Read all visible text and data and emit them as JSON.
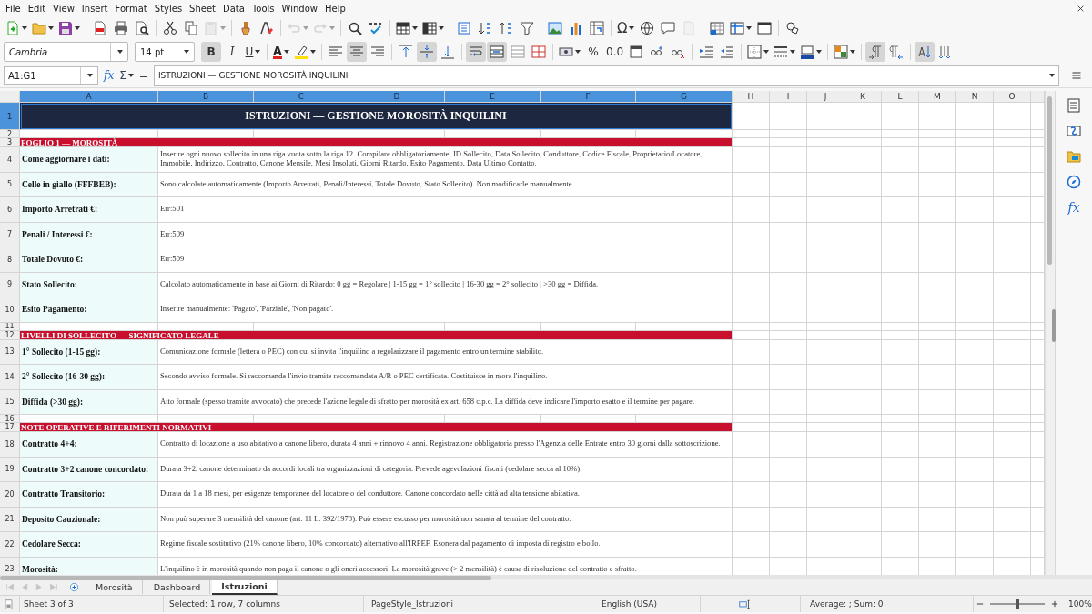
{
  "menu": [
    "File",
    "Edit",
    "View",
    "Insert",
    "Format",
    "Styles",
    "Sheet",
    "Data",
    "Tools",
    "Window",
    "Help"
  ],
  "standard_bar": [
    {
      "kind": "new",
      "dropdown": true,
      "disabled": false
    },
    {
      "kind": "open",
      "dropdown": true,
      "disabled": false
    },
    {
      "kind": "save",
      "dropdown": true,
      "disabled": false
    },
    {
      "kind": "separator"
    },
    {
      "kind": "pdf",
      "disabled": false
    },
    {
      "kind": "print",
      "disabled": false
    },
    {
      "kind": "preview",
      "disabled": false
    },
    {
      "kind": "separator"
    },
    {
      "kind": "cut",
      "disabled": false
    },
    {
      "kind": "copy",
      "disabled": false
    },
    {
      "kind": "paste",
      "dropdown": true,
      "disabled": true
    },
    {
      "kind": "separator"
    },
    {
      "kind": "clone",
      "disabled": false
    },
    {
      "kind": "clear",
      "disabled": false
    },
    {
      "kind": "separator"
    },
    {
      "kind": "undo",
      "dropdown": true,
      "disabled": true
    },
    {
      "kind": "redo",
      "dropdown": true,
      "disabled": true
    },
    {
      "kind": "separator"
    },
    {
      "kind": "find",
      "disabled": false
    },
    {
      "kind": "spell",
      "disabled": false
    },
    {
      "kind": "separator"
    },
    {
      "kind": "row",
      "dropdown": true,
      "disabled": false
    },
    {
      "kind": "column",
      "dropdown": true,
      "disabled": false
    },
    {
      "kind": "separator"
    },
    {
      "kind": "sort",
      "disabled": false
    },
    {
      "kind": "sortasc",
      "disabled": false
    },
    {
      "kind": "sortdesc",
      "disabled": false
    },
    {
      "kind": "filter",
      "disabled": false
    },
    {
      "kind": "separator"
    },
    {
      "kind": "image",
      "disabled": false
    },
    {
      "kind": "chart",
      "disabled": false
    },
    {
      "kind": "pivot",
      "disabled": false
    },
    {
      "kind": "separator"
    },
    {
      "kind": "special",
      "label": "Ω",
      "dropdown": true,
      "disabled": false
    },
    {
      "kind": "link",
      "disabled": false
    },
    {
      "kind": "comment",
      "disabled": false
    },
    {
      "kind": "headerfooter",
      "disabled": true
    },
    {
      "kind": "separator"
    },
    {
      "kind": "printarea",
      "disabled": false
    },
    {
      "kind": "freeze",
      "dropdown": true,
      "disabled": false
    },
    {
      "kind": "split",
      "disabled": false
    },
    {
      "kind": "separator"
    },
    {
      "kind": "draw",
      "disabled": false
    }
  ],
  "font_name": "Cambria",
  "font_size": "14 pt",
  "format_bar": [
    {
      "kind": "bold",
      "label": "B",
      "on": true
    },
    {
      "kind": "italic",
      "label": "I",
      "on": false
    },
    {
      "kind": "underline",
      "label": "U",
      "dropdown": true,
      "on": false
    },
    {
      "kind": "separator"
    },
    {
      "kind": "fontcolor",
      "label": "A",
      "dropdown": true,
      "on": false
    },
    {
      "kind": "highlight",
      "dropdown": true,
      "on": false
    },
    {
      "kind": "separator"
    },
    {
      "kind": "alignleft",
      "on": false
    },
    {
      "kind": "aligncenter",
      "on": true
    },
    {
      "kind": "alignright",
      "on": false
    },
    {
      "kind": "separator"
    },
    {
      "kind": "aligntop",
      "on": false
    },
    {
      "kind": "alignmiddle",
      "on": true
    },
    {
      "kind": "alignbottom",
      "on": false
    },
    {
      "kind": "separator"
    },
    {
      "kind": "wrap",
      "on": true
    },
    {
      "kind": "mergecenter",
      "on": true
    },
    {
      "kind": "merge",
      "on": false
    },
    {
      "kind": "unmerge",
      "on": false
    },
    {
      "kind": "separator"
    },
    {
      "kind": "currency",
      "dropdown": true,
      "on": false
    },
    {
      "kind": "percent",
      "label": "%",
      "on": false
    },
    {
      "kind": "number",
      "label": "0.0",
      "on": false
    },
    {
      "kind": "date",
      "on": false
    },
    {
      "kind": "adddecimal",
      "on": false
    },
    {
      "kind": "deldecimal",
      "on": false
    },
    {
      "kind": "separator"
    },
    {
      "kind": "indent",
      "on": false
    },
    {
      "kind": "outdent",
      "on": false
    },
    {
      "kind": "separator"
    },
    {
      "kind": "borders",
      "dropdown": true,
      "on": false
    },
    {
      "kind": "borderstyle",
      "dropdown": true,
      "on": false
    },
    {
      "kind": "bordercolor",
      "dropdown": true,
      "on": false
    },
    {
      "kind": "separator"
    },
    {
      "kind": "conditional",
      "dropdown": true,
      "on": false
    },
    {
      "kind": "separator"
    },
    {
      "kind": "ltr",
      "on": true
    },
    {
      "kind": "rtl",
      "on": false
    },
    {
      "kind": "separator"
    },
    {
      "kind": "orientation",
      "on": true
    },
    {
      "kind": "stacked",
      "on": false
    }
  ],
  "formula_bar": {
    "cell_ref": "A1:G1",
    "function_wizard": "fx",
    "sum": "Σ",
    "equals": "=",
    "content": "ISTRUZIONI — GESTIONE MOROSITÀ INQUILINI"
  },
  "sidebar": [
    {
      "kind": "properties"
    },
    {
      "kind": "styles"
    },
    {
      "kind": "gallery"
    },
    {
      "kind": "navigator"
    },
    {
      "kind": "functions",
      "label": "fx"
    }
  ],
  "columns": [
    {
      "label": "A",
      "selected": true
    },
    {
      "label": "B",
      "selected": true
    },
    {
      "label": "C",
      "selected": true
    },
    {
      "label": "D",
      "selected": true
    },
    {
      "label": "E",
      "selected": true
    },
    {
      "label": "F",
      "selected": true
    },
    {
      "label": "G",
      "selected": true
    },
    {
      "label": "H",
      "selected": false
    },
    {
      "label": "I",
      "selected": false
    },
    {
      "label": "J",
      "selected": false
    },
    {
      "label": "K",
      "selected": false
    },
    {
      "label": "L",
      "selected": false
    },
    {
      "label": "M",
      "selected": false
    },
    {
      "label": "N",
      "selected": false
    },
    {
      "label": "O",
      "selected": false
    }
  ],
  "rows": [
    {
      "number": "1",
      "selected": true,
      "kind": "title",
      "text": "ISTRUZIONI — GESTIONE MOROSITÀ INQUILINI"
    },
    {
      "number": "2",
      "selected": false,
      "kind": "blank"
    },
    {
      "number": "3",
      "selected": false,
      "kind": "section",
      "text": "FOGLIO 1 — MOROSITÀ"
    },
    {
      "number": "4",
      "selected": false,
      "kind": "entry",
      "label": "Come aggiornare i dati:",
      "text": "Inserire ogni nuovo sollecito in una riga vuota sotto la riga 12. Compilare obbligatoriamente: ID Sollecito, Data Sollecito, Conduttore, Codice Fiscale, Proprietario/Locatore, Immobile, Indirizzo, Contratto, Canone Mensile, Mesi Insoluti, Giorni Ritardo, Esito Pagamento, Data Ultimo Contatto."
    },
    {
      "number": "5",
      "selected": false,
      "kind": "entry",
      "label": "Celle in giallo (FFFBEB):",
      "text": "Sono calcolate automaticamente (Importo Arretrati, Penali/Interessi, Totale Dovuto, Stato Sollecito). Non modificarle manualmente."
    },
    {
      "number": "6",
      "selected": false,
      "kind": "entry",
      "label": "Importo Arretrati €:",
      "text": "Err:501"
    },
    {
      "number": "7",
      "selected": false,
      "kind": "entry",
      "label": "Penali / Interessi €:",
      "text": "Err:509"
    },
    {
      "number": "8",
      "selected": false,
      "kind": "entry",
      "label": "Totale Dovuto €:",
      "text": "Err:509"
    },
    {
      "number": "9",
      "selected": false,
      "kind": "entry",
      "label": "Stato Sollecito:",
      "text": "Calcolato automaticamente in base ai Giorni di Ritardo: 0 gg = Regolare | 1-15 gg = 1° sollecito | 16-30 gg = 2° sollecito | >30 gg = Diffida."
    },
    {
      "number": "10",
      "selected": false,
      "kind": "entry",
      "label": "Esito Pagamento:",
      "text": "Inserire manualmente: 'Pagato', 'Parziale', 'Non pagato'."
    },
    {
      "number": "11",
      "selected": false,
      "kind": "blank"
    },
    {
      "number": "12",
      "selected": false,
      "kind": "section",
      "text": "LIVELLI DI SOLLECITO — SIGNIFICATO LEGALE"
    },
    {
      "number": "13",
      "selected": false,
      "kind": "entry",
      "label": "1° Sollecito (1-15 gg):",
      "text": "Comunicazione formale (lettera o PEC) con cui si invita l'inquilino a regolarizzare il pagamento entro un termine stabilito."
    },
    {
      "number": "14",
      "selected": false,
      "kind": "entry",
      "label": "2° Sollecito (16-30 gg):",
      "text": "Secondo avviso formale. Si raccomanda l'invio tramite raccomandata A/R o PEC certificata. Costituisce in mora l'inquilino."
    },
    {
      "number": "15",
      "selected": false,
      "kind": "entry",
      "label": "Diffida (>30 gg):",
      "text": "Atto formale (spesso tramite avvocato) che precede l'azione legale di sfratto per morosità ex art. 658 c.p.c. La diffida deve indicare l'importo esatto e il termine per pagare."
    },
    {
      "number": "16",
      "selected": false,
      "kind": "blank"
    },
    {
      "number": "17",
      "selected": false,
      "kind": "section",
      "text": "NOTE OPERATIVE E RIFERIMENTI NORMATIVI"
    },
    {
      "number": "18",
      "selected": false,
      "kind": "entry",
      "label": "Contratto 4+4:",
      "text": "Contratto di locazione a uso abitativo a canone libero, durata 4 anni + rinnovo 4 anni. Registrazione obbligatoria presso l'Agenzia delle Entrate entro 30 giorni dalla sottoscrizione."
    },
    {
      "number": "19",
      "selected": false,
      "kind": "entry",
      "label": "Contratto 3+2 canone concordato:",
      "text": "Durata 3+2, canone determinato da accordi locali tra organizzazioni di categoria. Prevede agevolazioni fiscali (cedolare secca al 10%)."
    },
    {
      "number": "20",
      "selected": false,
      "kind": "entry",
      "label": "Contratto Transitorio:",
      "text": "Durata da 1 a 18 mesi, per esigenze temporanee del locatore o del conduttore. Canone concordato nelle città ad alta tensione abitativa."
    },
    {
      "number": "21",
      "selected": false,
      "kind": "entry",
      "label": "Deposito Cauzionale:",
      "text": "Non può superare 3 mensilità del canone (art. 11 L. 392/1978). Può essere escusso per morosità non sanata al termine del contratto."
    },
    {
      "number": "22",
      "selected": false,
      "kind": "entry",
      "label": "Cedolare Secca:",
      "text": "Regime fiscale sostitutivo (21% canone libero, 10% concordato) alternativo all'IRPEF. Esonera dal pagamento di imposta di registro e bollo."
    },
    {
      "number": "23",
      "selected": false,
      "kind": "entry",
      "label": "Morosità:",
      "text": "L'inquilino è in morosità quando non paga il canone o gli oneri accessori. La morosità grave (> 2 mensilità) è causa di risoluzione del contratto e sfratto."
    }
  ],
  "tabs": [
    {
      "label": "Morosità",
      "selected": false
    },
    {
      "label": "Dashboard",
      "selected": false
    },
    {
      "label": "Istruzioni",
      "selected": true
    }
  ],
  "status_bar": {
    "sheet": "Sheet 3 of 3",
    "selection": "Selected: 1 row, 7 columns",
    "page_style": "PageStyle_Istruzioni",
    "language": "English (USA)",
    "sum": "Average: ; Sum: 0",
    "zoom": "100%",
    "zoom_slider": {
      "level": 0.5
    }
  }
}
